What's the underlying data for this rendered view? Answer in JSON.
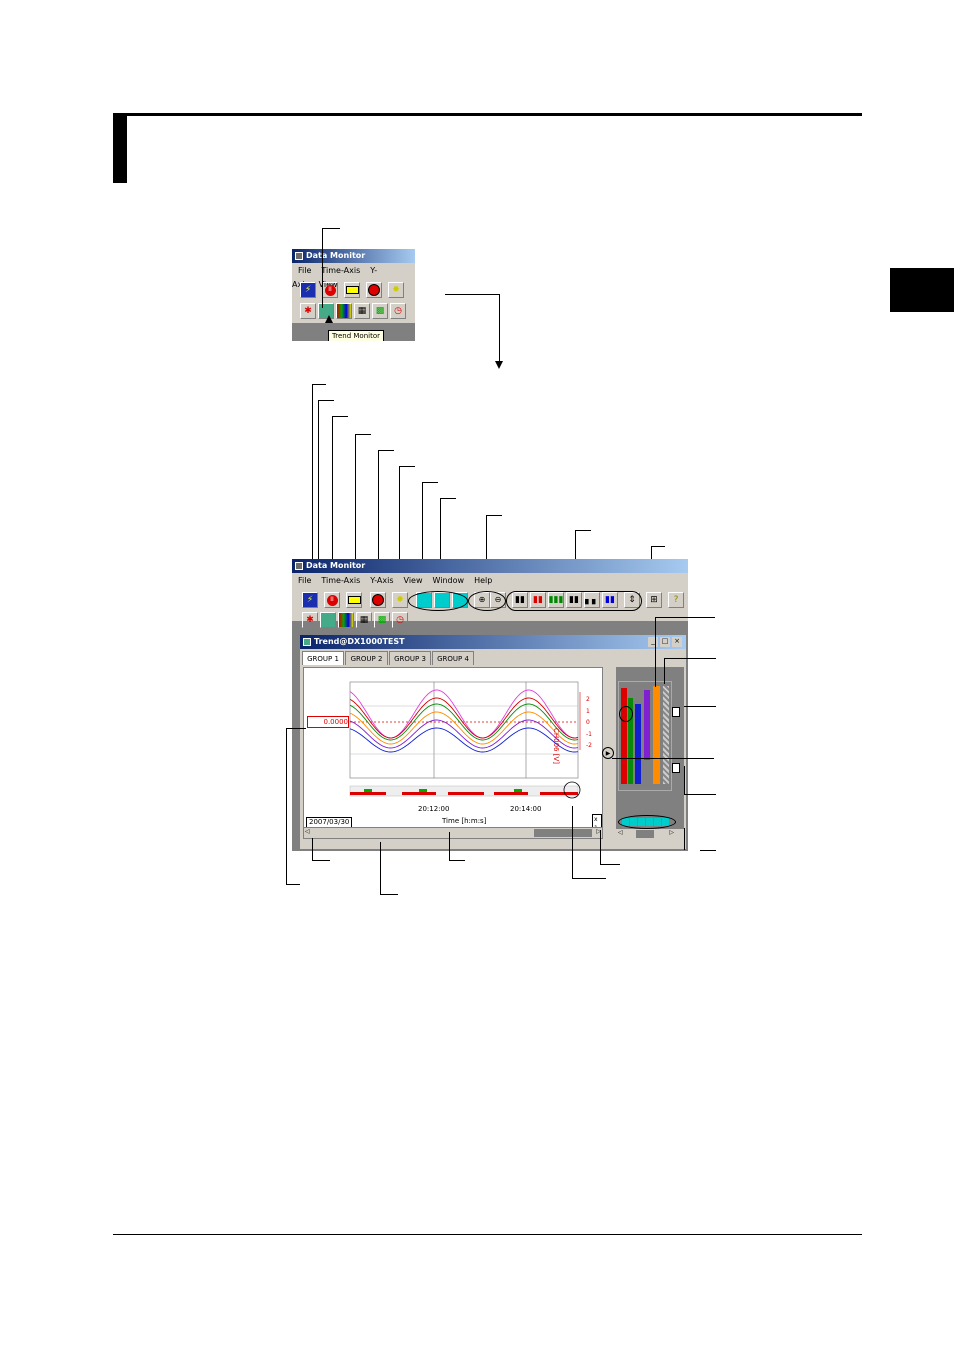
{
  "small_window": {
    "title": "Data Monitor",
    "menu": [
      "File",
      "Time-Axis",
      "Y-Axis",
      "View"
    ],
    "tooltip": "Trend Monitor"
  },
  "main_window": {
    "title": "Data Monitor",
    "menu": [
      "File",
      "Time-Axis",
      "Y-Axis",
      "View",
      "Window",
      "Help"
    ]
  },
  "trend_window": {
    "title": "Trend@DX1000TEST",
    "tabs": [
      "GROUP 1",
      "GROUP 2",
      "GROUP 3",
      "GROUP 4"
    ],
    "cursor_value": "0.0000",
    "date": "2007/03/30",
    "x_ticks": [
      "20:12:00",
      "20:14:00"
    ],
    "x_label": "Time [h:m:s]",
    "y_label": "CH006 [V]",
    "y_ticks": [
      "2",
      "1",
      "0",
      "-1",
      "-2"
    ],
    "zoom_box": "x 1"
  },
  "colors": {
    "titlebar": "#0a246a",
    "series": [
      "#d00000",
      "#0a8a0a",
      "#1020d0",
      "#8020d0",
      "#ff8c00",
      "#e040e0"
    ],
    "status": "#00cccc"
  },
  "chart_data": {
    "type": "line",
    "x_ticks": [
      "20:12:00",
      "20:14:00"
    ],
    "xlabel": "Time [h:m:s]",
    "ylabel": "CH006 [V]",
    "y_ticks": [
      "2",
      "1",
      "0",
      "-1",
      "-2"
    ],
    "ylim": [
      -2,
      2
    ]
  }
}
